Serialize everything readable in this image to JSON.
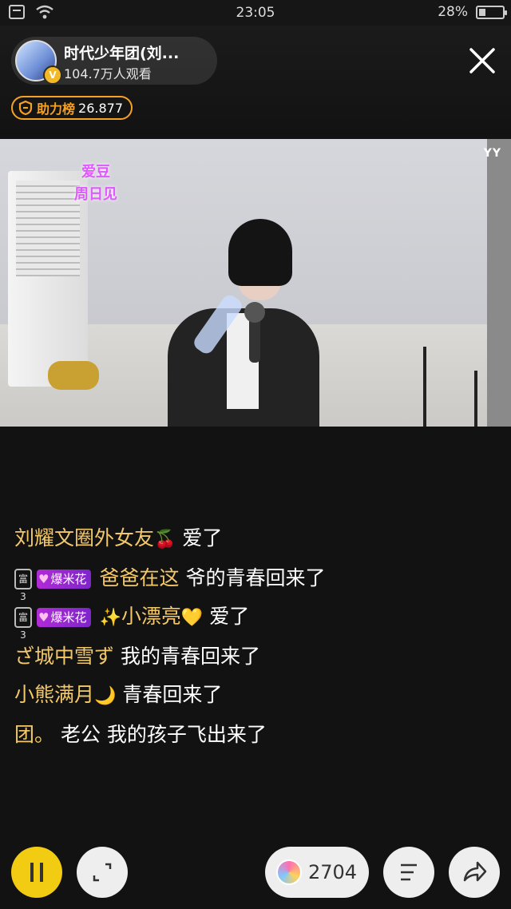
{
  "status_bar": {
    "time": "23:05",
    "battery_percent": "28%",
    "battery_level": 0.28
  },
  "header": {
    "host_name": "时代少年团(刘...",
    "viewers": "104.7万人观看",
    "verified_badge": "V",
    "rank_label": "助力榜",
    "rank_value": "26.877"
  },
  "video": {
    "watermark": "YY",
    "stage_logo_line1": "爱豆",
    "stage_logo_line2": "周日见"
  },
  "chat": {
    "messages": [
      {
        "name": "刘耀文圈外女友",
        "name_emoji": "🍒",
        "text": "爱了"
      },
      {
        "rank_badge": "富3",
        "pill": "爆米花",
        "name": "爸爸在这",
        "text": "爷的青春回来了"
      },
      {
        "rank_badge": "富3",
        "pill": "爆米花",
        "name_prefix_emoji": "✨",
        "name": "小漂亮",
        "name_emoji": "💛",
        "text": "爱了"
      },
      {
        "name": "ざ城中雪ず",
        "text": "我的青春回来了"
      },
      {
        "name": "小熊满月",
        "name_emoji": "🌙",
        "text": "青春回来了"
      },
      {
        "name": "团。",
        "text": "老公 我的孩子飞出来了"
      }
    ]
  },
  "bottom_bar": {
    "gift_count": "2704"
  },
  "colors": {
    "accent_yellow": "#f2cc12",
    "rank_orange": "#f5a126",
    "name_gold": "#f3c86b"
  },
  "icons": [
    "wifi-icon",
    "sim-icon",
    "battery-icon",
    "close-icon",
    "shield-icon",
    "pause-icon",
    "fullscreen-icon",
    "lollipop-icon",
    "menu-icon",
    "share-icon"
  ]
}
